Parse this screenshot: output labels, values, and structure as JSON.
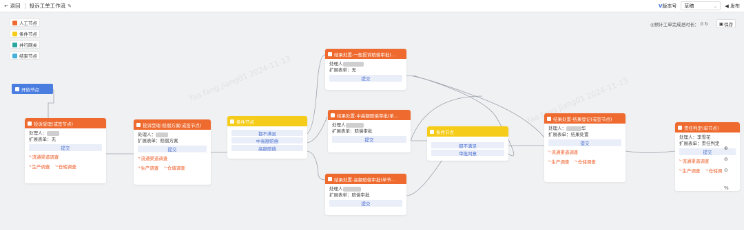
{
  "topbar": {
    "back_label": "← 返回",
    "title": "投诉工单工作流",
    "version_label": "版本号",
    "version_value": "草稿",
    "publish_label": "发布"
  },
  "legend": [
    {
      "label": "人工节点",
      "color": "#ee6a2e"
    },
    {
      "label": "条件节点",
      "color": "#f5cc1a"
    },
    {
      "label": "并行网关",
      "color": "#2aa6a0"
    },
    {
      "label": "结束节点",
      "color": "#46b2d9"
    }
  ],
  "estimate_label": "◎预计工单完成总时长：",
  "estimate_value": "0",
  "save_label": "保存",
  "start_label": "开始节点",
  "watermark": "faa.fang.jiang01  2024-11-13",
  "nodes": {
    "n1": {
      "title": "投诉受理(或签节点)",
      "handler": "处理人：",
      "form": "扩展表单：无",
      "submit": "提交",
      "tags": [
        "流通渠道调查",
        "生产调查",
        "仓储调查"
      ]
    },
    "n2": {
      "title": "投诉受理-赔偿方案(或签节点)",
      "handler": "处理人：",
      "form": "扩展表单：赔偿方案",
      "submit": "提交",
      "tags": [
        "流通渠道调查",
        "生产调查",
        "仓储调查"
      ]
    },
    "c1": {
      "title": "条件节点",
      "conds": [
        "都不满足",
        "中高额赔偿",
        "高额赔偿"
      ]
    },
    "n3": {
      "title": "结果处置-一般投诉赔偿审批(...",
      "handler": "处理人",
      "form": "扩展表单：无",
      "submit": "提交"
    },
    "n4": {
      "title": "结果处置-中高额赔偿审批(单...",
      "handler": "处理人",
      "form": "扩展表单：赔偿审批",
      "submit": "提交"
    },
    "n5": {
      "title": "结果处置-高额赔偿审批(单节...",
      "handler": "处理人",
      "form": "扩展表单：赔偿审批",
      "submit": "提交"
    },
    "c2": {
      "title": "条件节点",
      "conds": [
        "都不满足",
        "审批同意"
      ]
    },
    "n6": {
      "title": "结果处置-结果登记(或签节点)",
      "handler": "处理人：",
      "handler_suffix": "华",
      "form": "扩展表单：结果处置",
      "submit": "提交",
      "tags": [
        "流通渠道调查",
        "生产调查",
        "仓储调查"
      ]
    },
    "n7": {
      "title": "责任判定(单节点)",
      "handler": "处理人：李雪花",
      "form": "扩展表单：责任判定",
      "submit": "提交",
      "tags": [
        "流通渠道调查",
        "生产调查",
        "仓储调"
      ]
    }
  },
  "zoom_controls": [
    "⊕",
    "⊖",
    "⊙",
    "%"
  ]
}
